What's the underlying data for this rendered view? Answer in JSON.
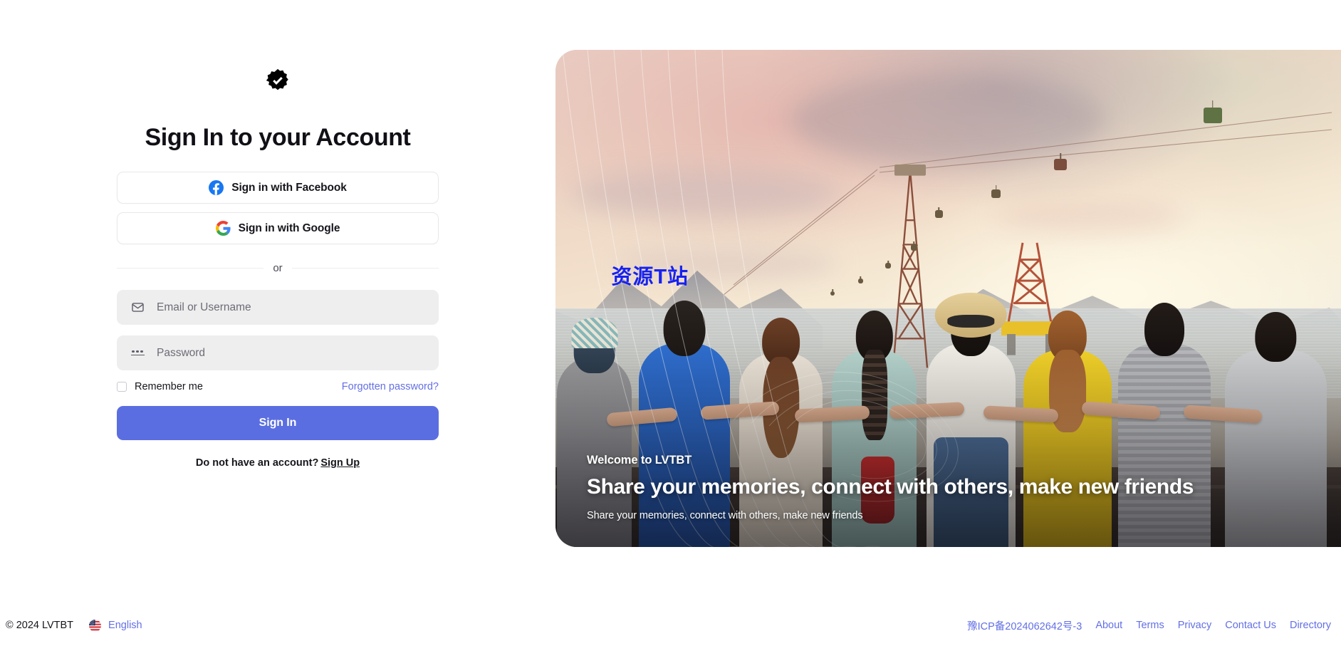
{
  "auth": {
    "logo_icon": "verified-badge-icon",
    "title": "Sign In to your Account",
    "social_buttons": [
      {
        "label": "Sign in with Facebook",
        "icon": "facebook-icon"
      },
      {
        "label": "Sign in with Google",
        "icon": "google-icon"
      }
    ],
    "divider_label": "or",
    "fields": {
      "email": {
        "placeholder": "Email or Username",
        "value": "",
        "icon": "envelope-icon"
      },
      "password": {
        "placeholder": "Password",
        "value": "",
        "icon": "password-dots-icon"
      }
    },
    "remember_label": "Remember me",
    "remember_checked": false,
    "forgot_label": "Forgotten password?",
    "submit_label": "Sign In",
    "signup_prompt": "Do not have an account?",
    "signup_label": "Sign Up",
    "accent_color": "#5b6ee1",
    "link_color": "#6370e4",
    "field_bg": "#eeeeee"
  },
  "hero": {
    "watermark": "资源T站",
    "watermark_color": "#1722ef",
    "eyebrow": "Welcome to LVTBT",
    "headline": "Share your memories, connect with others, make new friends",
    "subtitle": "Share your memories, connect with others, make new friends"
  },
  "footer": {
    "copyright": "© 2024 LVTBT",
    "language": "English",
    "flag_icon": "us-flag-icon",
    "icp": "豫ICP备2024062642号-3",
    "links": [
      "About",
      "Terms",
      "Privacy",
      "Contact Us",
      "Directory"
    ]
  }
}
